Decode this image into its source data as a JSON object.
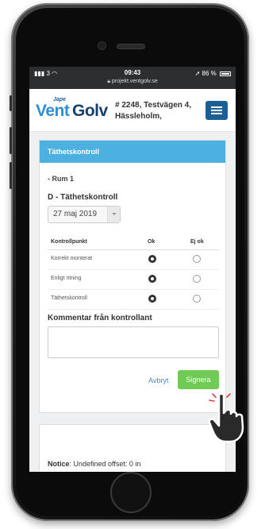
{
  "status_bar": {
    "signal": "3",
    "time": "09:43",
    "url": "projekt.ventgolv.se",
    "battery": "86 %"
  },
  "header": {
    "logo_jape": "Jape",
    "logo_vent": "Vent",
    "logo_golv": "Golv",
    "address_line1": "# 2248, Testvägen 4,",
    "address_line2": "Hässleholm,"
  },
  "card": {
    "title": "Täthetskontroll",
    "room": "- Rum 1",
    "section_title": "D - Täthetskontroll",
    "date": "27 maj 2019",
    "table": {
      "headers": [
        "Kontrollpunkt",
        "Ok",
        "Ej ok"
      ],
      "rows": [
        {
          "label": "Korrekt monterat",
          "ok": true
        },
        {
          "label": "Enligt ritning",
          "ok": true
        },
        {
          "label": "Täthetskontroll",
          "ok": true
        }
      ]
    },
    "comment_label": "Kommentar från kontrollant",
    "comment_value": "",
    "cancel_label": "Avbryt",
    "sign_label": "Signera"
  },
  "notice": {
    "label": "Notice",
    "text": ": Undefined offset: 0 in"
  },
  "colors": {
    "card_header": "#4cb1e0",
    "sign_button": "#6fcb55",
    "menu_button": "#1c5f94"
  }
}
